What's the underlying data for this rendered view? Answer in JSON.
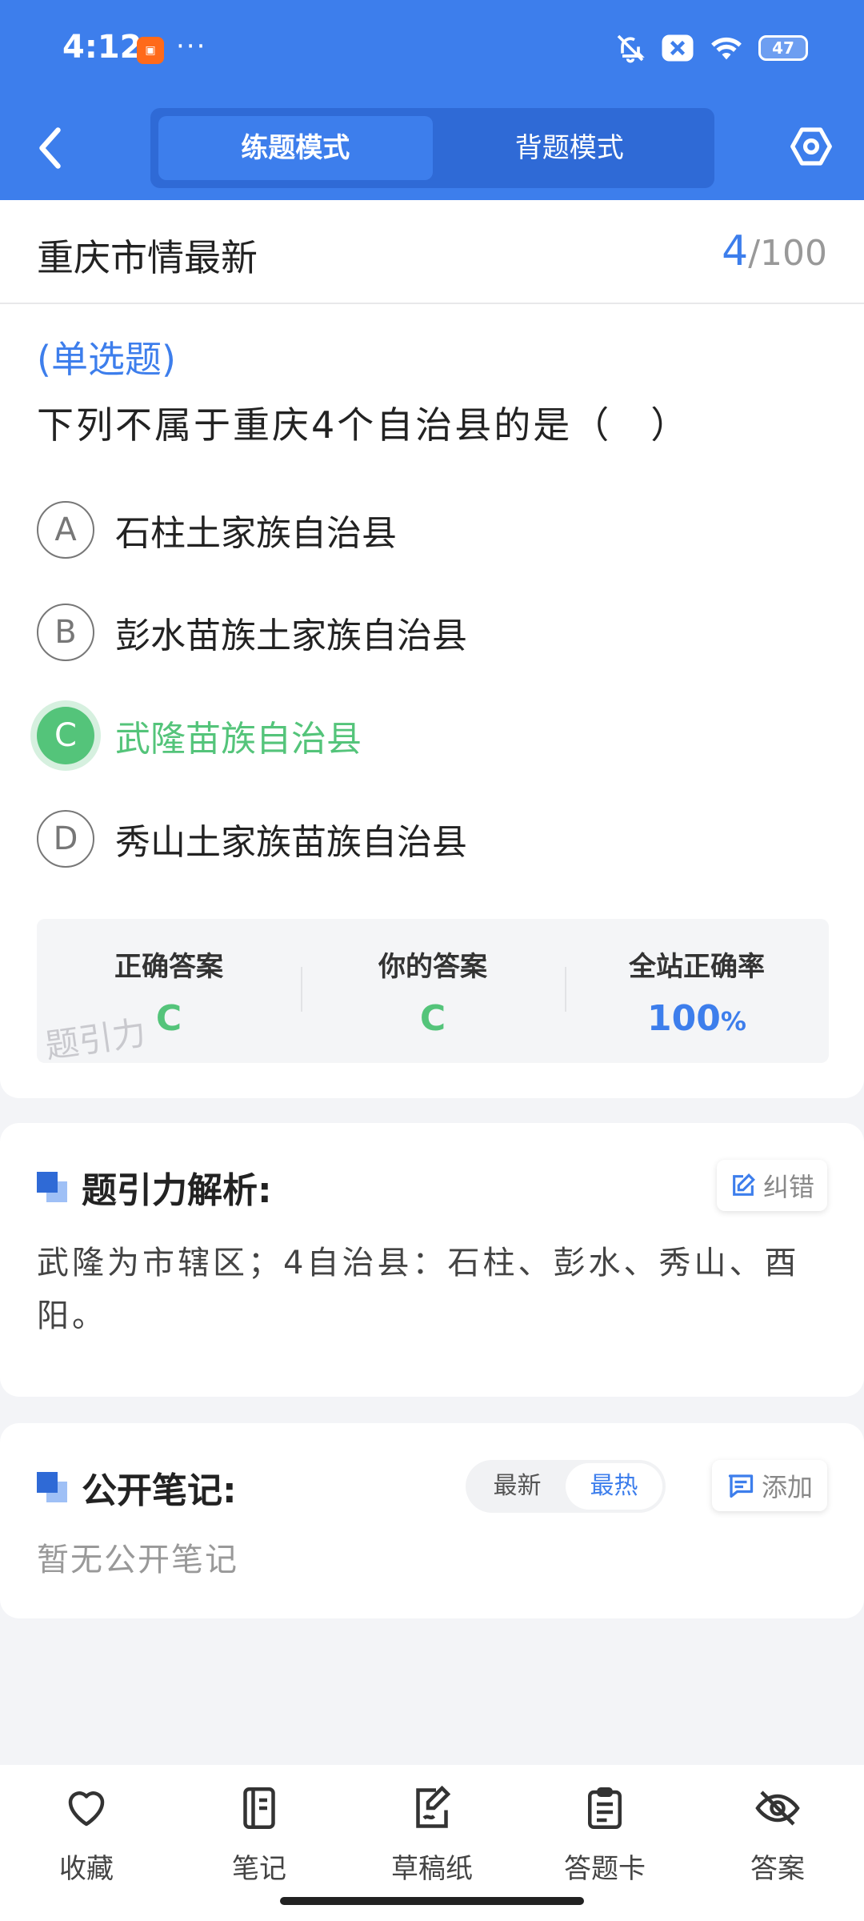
{
  "status_bar": {
    "time": "4:12",
    "dots": "···",
    "battery": "47"
  },
  "header": {
    "modes": [
      {
        "label": "练题模式",
        "active": true
      },
      {
        "label": "背题模式",
        "active": false
      }
    ]
  },
  "question_card": {
    "subject": "重庆市情最新",
    "progress": {
      "current": "4",
      "total": "/100"
    },
    "question_type": "(单选题)",
    "question_text": "下列不属于重庆4个自治县的是（　）",
    "options": [
      {
        "letter": "A",
        "text": "石柱土家族自治县",
        "correct": false
      },
      {
        "letter": "B",
        "text": "彭水苗族土家族自治县",
        "correct": false
      },
      {
        "letter": "C",
        "text": "武隆苗族自治县",
        "correct": true
      },
      {
        "letter": "D",
        "text": "秀山土家族苗族自治县",
        "correct": false
      }
    ],
    "answer_box": {
      "correct_label": "正确答案",
      "correct_value": "C",
      "your_label": "你的答案",
      "your_value": "C",
      "rate_label": "全站正确率",
      "rate_value": "100",
      "rate_unit": "%"
    },
    "watermark": "题引力"
  },
  "explanation": {
    "title": "题引力解析:",
    "fix_label": "纠错",
    "text": "武隆为市辖区；4自治县：石柱、彭水、秀山、酉阳。"
  },
  "notes": {
    "title": "公开笔记:",
    "sort_options": [
      {
        "label": "最新",
        "active": false
      },
      {
        "label": "最热",
        "active": true
      }
    ],
    "add_label": "添加",
    "empty_text": "暂无公开笔记"
  },
  "bottom_nav": [
    {
      "label": "收藏",
      "icon": "heart-icon"
    },
    {
      "label": "笔记",
      "icon": "notebook-icon"
    },
    {
      "label": "草稿纸",
      "icon": "draft-paper-icon"
    },
    {
      "label": "答题卡",
      "icon": "answer-sheet-icon"
    },
    {
      "label": "答案",
      "icon": "eye-off-icon"
    }
  ],
  "colors": {
    "brand": "#3d7eec",
    "correct": "#54c47a"
  }
}
